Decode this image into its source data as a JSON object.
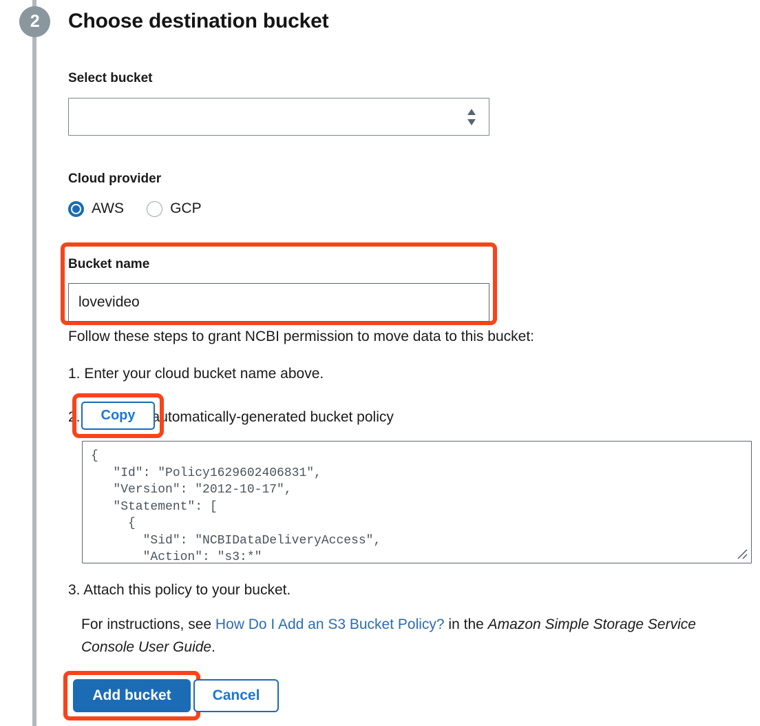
{
  "step": {
    "number": "2",
    "title": "Choose destination bucket"
  },
  "colors": {
    "accent_blue": "#1a6bb3",
    "link_blue": "#2b6cb0",
    "highlight_red": "#f9431a",
    "step_gray": "#8b979f",
    "rail_gray": "#b0b7bd"
  },
  "select_bucket": {
    "label": "Select bucket",
    "value": "",
    "options": []
  },
  "cloud_provider": {
    "label": "Cloud provider",
    "selected": "AWS",
    "options": [
      {
        "label": "AWS",
        "checked": true
      },
      {
        "label": "GCP",
        "checked": false
      }
    ]
  },
  "bucket_name": {
    "label": "Bucket name",
    "value": "lovevideo",
    "placeholder": ""
  },
  "instructions": {
    "intro": "Follow these steps to grant NCBI permission to move data to this bucket:",
    "step1": "1. Enter your cloud bucket name above.",
    "step2_marker": "2.",
    "step2_text": "automatically-generated bucket policy",
    "copy_label": "Copy",
    "step3": "3. Attach this policy to your bucket.",
    "guide_prefix": "For instructions, see ",
    "guide_link": "How Do I Add an S3 Bucket Policy?",
    "guide_middle": " in the ",
    "guide_italic": "Amazon Simple Storage Service Console User Guide",
    "guide_suffix": "."
  },
  "policy": {
    "text": "{\n   \"Id\": \"Policy1629602406831\",\n   \"Version\": \"2012-10-17\",\n   \"Statement\": [\n     {\n       \"Sid\": \"NCBIDataDeliveryAccess\",\n       \"Action\": \"s3:*\""
  },
  "footer": {
    "add_bucket_label": "Add bucket",
    "cancel_label": "Cancel"
  }
}
